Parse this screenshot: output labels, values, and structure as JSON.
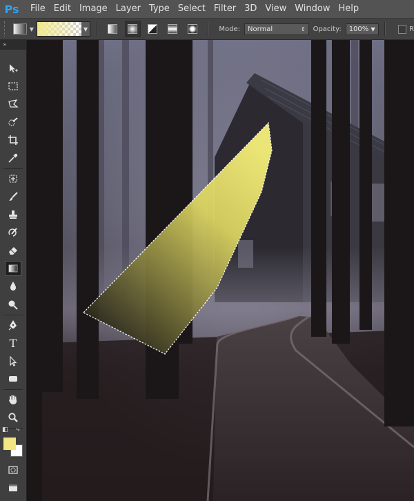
{
  "app": {
    "logo": "Ps"
  },
  "menu": [
    "File",
    "Edit",
    "Image",
    "Layer",
    "Type",
    "Select",
    "Filter",
    "3D",
    "View",
    "Window",
    "Help"
  ],
  "options_bar": {
    "mode_label": "Mode:",
    "mode_value": "Normal",
    "opacity_label": "Opacity:",
    "opacity_value": "100%",
    "cut_label": "R",
    "gradient_preview_color": "#f0e88c",
    "gradient_types": [
      "linear-gradient-icon",
      "radial-gradient-icon",
      "angle-gradient-icon",
      "reflected-gradient-icon",
      "diamond-gradient-icon"
    ],
    "active_gradient_type": "radial-gradient-icon"
  },
  "toolbox": {
    "collapse_label": "»",
    "tools": [
      "move-tool-icon",
      "marquee-tool-icon",
      "lasso-tool-icon",
      "quick-selection-icon",
      "crop-tool-icon",
      "eyedropper-icon",
      "healing-brush-icon",
      "brush-tool-icon",
      "clone-stamp-icon",
      "history-brush-icon",
      "eraser-icon",
      "gradient-tool-icon",
      "blur-tool-icon",
      "dodge-tool-icon",
      "pen-tool-icon",
      "type-tool-icon",
      "path-selection-icon",
      "rectangle-tool-icon",
      "hand-tool-icon",
      "zoom-tool-icon"
    ],
    "active_tool": "gradient-tool-icon",
    "type_tool_glyph": "T",
    "foreground_color": "#f2e784",
    "background_color": "#ffffff"
  },
  "canvas": {
    "scene": "foggy forest with wooden house and path",
    "selection_fill_top": "#f6ef7a",
    "selection_fill_bottom": "#2f2d1e"
  }
}
